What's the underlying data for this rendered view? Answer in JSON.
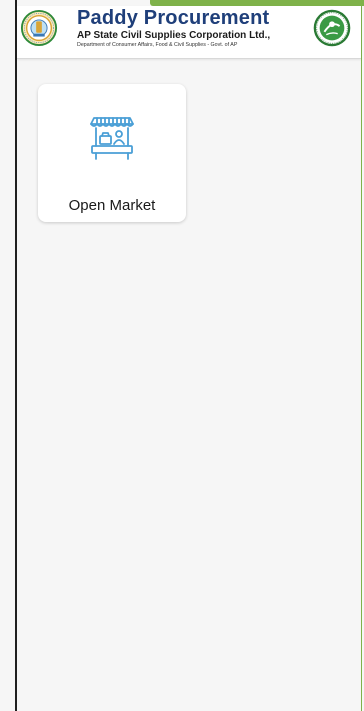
{
  "header": {
    "title": "Paddy Procurement",
    "subtitle": "AP State Civil Supplies Corporation Ltd.,",
    "department": "Department of Consumer Affairs, Food & Civil Supplies - Govt. of AP",
    "left_logo": "ap-govt-emblem-icon",
    "right_logo": "civil-supplies-logo-icon"
  },
  "tiles": [
    {
      "label": "Open Market",
      "icon": "market-stall-icon"
    }
  ],
  "colors": {
    "title": "#1f3f7a",
    "accent": "#7fb24a",
    "icon": "#4a9fd6",
    "background": "#f6f6f6"
  }
}
